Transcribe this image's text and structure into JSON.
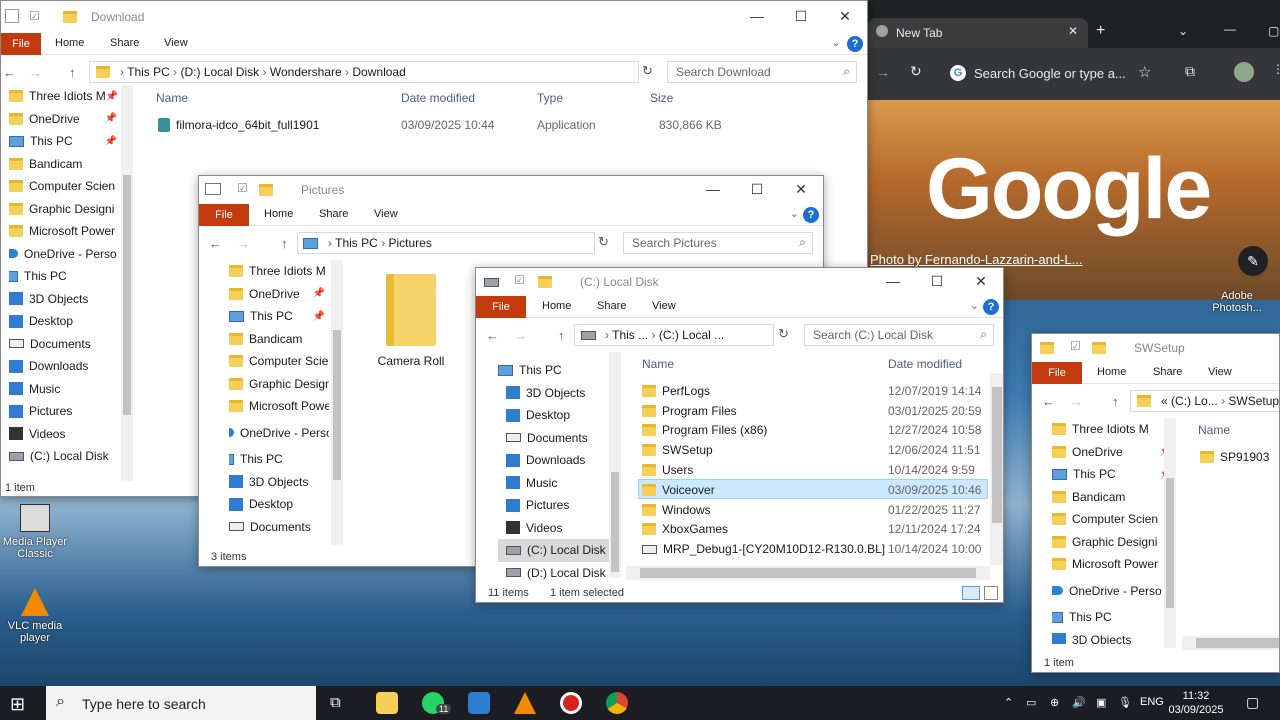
{
  "desktop": {
    "icons": [
      {
        "label": "Media Player Classic"
      },
      {
        "label": "VLC media player"
      },
      {
        "label": "Adobe Photosh..."
      }
    ]
  },
  "chrome": {
    "tab_title": "New Tab",
    "omnibox_placeholder": "Search Google or type a...",
    "logo_text": "Google",
    "photo_credit": "Photo by Fernando-Lazzarin-and-L..."
  },
  "win_download": {
    "title": "Download",
    "ribbon": {
      "file": "File",
      "home": "Home",
      "share": "Share",
      "view": "View"
    },
    "breadcrumb": [
      "This PC",
      "(D:) Local Disk",
      "Wondershare",
      "Download"
    ],
    "search_placeholder": "Search Download",
    "nav": [
      "Three Idiots M",
      "OneDrive",
      "This PC",
      "Bandicam",
      "Computer Scien",
      "Graphic Designi",
      "Microsoft Power",
      "OneDrive - Perso",
      "This PC",
      "3D Objects",
      "Desktop",
      "Documents",
      "Downloads",
      "Music",
      "Pictures",
      "Videos",
      "(C:) Local Disk"
    ],
    "columns": {
      "name": "Name",
      "date": "Date modified",
      "type": "Type",
      "size": "Size"
    },
    "files": [
      {
        "name": "filmora-idco_64bit_full1901",
        "date": "03/09/2025 10:44",
        "type": "Application",
        "size": "830,866 KB"
      }
    ],
    "status": "1 item"
  },
  "win_pictures": {
    "title": "Pictures",
    "ribbon": {
      "file": "File",
      "home": "Home",
      "share": "Share",
      "view": "View"
    },
    "breadcrumb": [
      "This PC",
      "Pictures"
    ],
    "search_placeholder": "Search Pictures",
    "nav": [
      "Three Idiots M",
      "OneDrive",
      "This PC",
      "Bandicam",
      "Computer Scien",
      "Graphic Designi",
      "Microsoft Power",
      "OneDrive - Perso",
      "This PC",
      "3D Objects",
      "Desktop",
      "Documents"
    ],
    "folder": "Camera Roll",
    "status": "3 items"
  },
  "win_local": {
    "title": "(C:) Local Disk",
    "ribbon": {
      "file": "File",
      "home": "Home",
      "share": "Share",
      "view": "View"
    },
    "breadcrumb": [
      "This ...",
      "(C:) Local ..."
    ],
    "search_placeholder": "Search (C:) Local Disk",
    "nav": [
      "This PC",
      "3D Objects",
      "Desktop",
      "Documents",
      "Downloads",
      "Music",
      "Pictures",
      "Videos",
      "(C:) Local Disk",
      "(D:) Local Disk"
    ],
    "columns": {
      "name": "Name",
      "date": "Date modified"
    },
    "files": [
      {
        "name": "PerfLogs",
        "date": "12/07/2019 14:14"
      },
      {
        "name": "Program Files",
        "date": "03/01/2025 20:59"
      },
      {
        "name": "Program Files (x86)",
        "date": "12/27/2024 10:58"
      },
      {
        "name": "SWSetup",
        "date": "12/06/2024 11:51"
      },
      {
        "name": "Users",
        "date": "10/14/2024 9:59"
      },
      {
        "name": "Voiceover",
        "date": "03/09/2025 10:46"
      },
      {
        "name": "Windows",
        "date": "01/22/2025 11:27"
      },
      {
        "name": "XboxGames",
        "date": "12/11/2024 17:24"
      },
      {
        "name": "MRP_Debug1-[CY20M10D12-R130.0.BL]",
        "date": "10/14/2024 10:00"
      }
    ],
    "status_count": "11 items",
    "status_selected": "1 item selected"
  },
  "win_swsetup": {
    "title": "SWSetup",
    "ribbon": {
      "file": "File",
      "home": "Home",
      "share": "Share",
      "view": "View"
    },
    "breadcrumb": [
      "«",
      "(C:) Lo...",
      "SWSetup"
    ],
    "nav": [
      "Three Idiots M",
      "OneDrive",
      "This PC",
      "Bandicam",
      "Computer Scien",
      "Graphic Designi",
      "Microsoft Power",
      "OneDrive - Perso",
      "This PC",
      "3D Objects"
    ],
    "column_name": "Name",
    "folder": "SP91903",
    "status": "1 item"
  },
  "taskbar": {
    "search_placeholder": "Type here to search",
    "badge": "11",
    "lang": "ENG",
    "time": "11:32",
    "date": "03/09/2025"
  }
}
